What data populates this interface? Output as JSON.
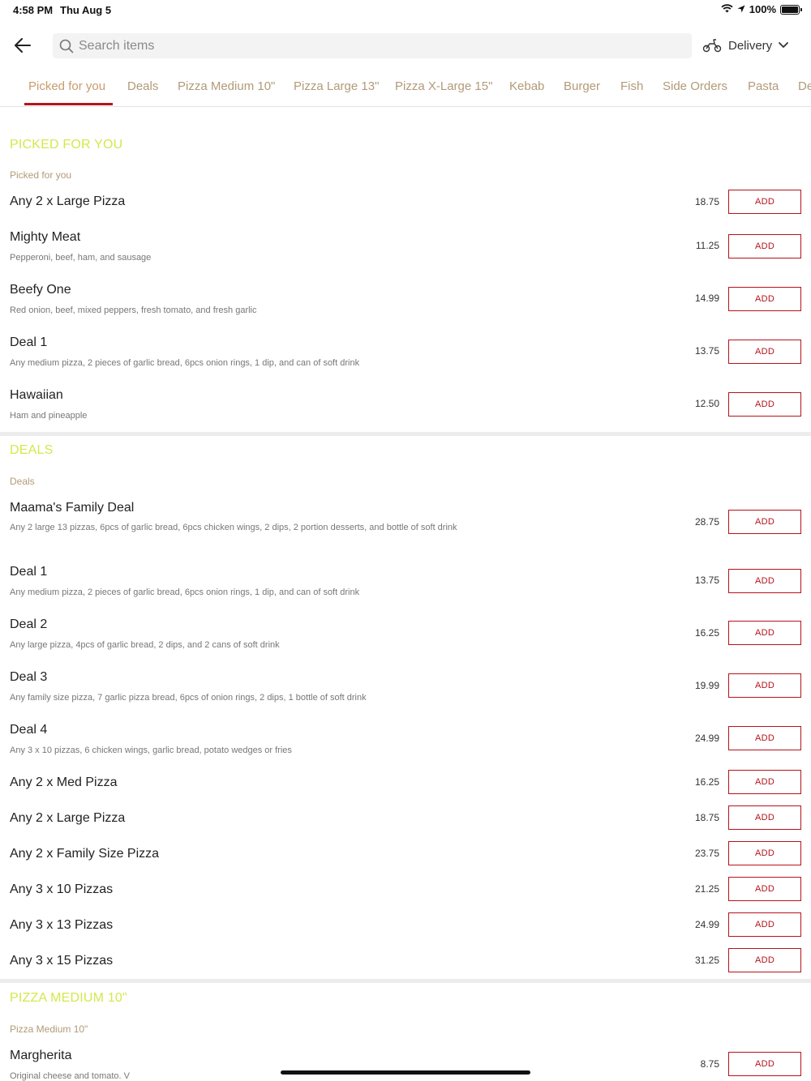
{
  "status_bar": {
    "time": "4:58 PM",
    "date": "Thu Aug 5",
    "battery": "100%",
    "battery_level": 1.0
  },
  "header": {
    "search_placeholder": "Search items",
    "delivery_label": "Delivery"
  },
  "tabs": [
    {
      "label": "Picked for you",
      "active": true
    },
    {
      "label": "Deals"
    },
    {
      "label": "Pizza Medium 10\""
    },
    {
      "label": "Pizza Large 13\""
    },
    {
      "label": "Pizza X-Large 15\""
    },
    {
      "label": "Kebab"
    },
    {
      "label": "Burger"
    },
    {
      "label": "Fish"
    },
    {
      "label": "Side Orders"
    },
    {
      "label": "Pasta"
    },
    {
      "label": "De"
    }
  ],
  "add_label": "ADD",
  "sections": [
    {
      "title": "PICKED FOR YOU",
      "subtitle": "Picked for you",
      "items": [
        {
          "name": "Any 2 x Large Pizza",
          "desc": "",
          "price": "18.75"
        },
        {
          "name": "Mighty Meat",
          "desc": "Pepperoni, beef, ham, and sausage",
          "price": "11.25"
        },
        {
          "name": "Beefy One",
          "desc": "Red onion, beef, mixed peppers, fresh tomato, and fresh garlic",
          "price": "14.99"
        },
        {
          "name": "Deal 1",
          "desc": "Any medium pizza, 2 pieces of garlic bread, 6pcs onion rings, 1 dip, and can of soft drink",
          "price": "13.75"
        },
        {
          "name": "Hawaiian",
          "desc": "Ham and pineapple",
          "price": "12.50"
        }
      ]
    },
    {
      "title": "DEALS",
      "subtitle": "Deals",
      "items": [
        {
          "name": "Maama's Family Deal",
          "desc": "Any 2 large 13 pizzas, 6pcs of garlic bread, 6pcs chicken wings, 2 dips, 2 portion desserts, and bottle of soft drink",
          "price": "28.75"
        },
        {
          "name": "Deal 1",
          "desc": "Any medium pizza, 2 pieces of garlic bread, 6pcs onion rings, 1 dip, and can of soft drink",
          "price": "13.75"
        },
        {
          "name": "Deal 2",
          "desc": "Any large pizza, 4pcs of garlic bread, 2 dips, and 2 cans of soft drink",
          "price": "16.25"
        },
        {
          "name": "Deal 3",
          "desc": "Any family size pizza, 7 garlic pizza bread, 6pcs of onion rings, 2 dips, 1 bottle of soft drink",
          "price": "19.99"
        },
        {
          "name": "Deal 4",
          "desc": "Any 3 x 10 pizzas, 6 chicken wings, garlic bread, potato wedges or fries",
          "price": "24.99"
        },
        {
          "name": "Any 2 x Med Pizza",
          "desc": "",
          "price": "16.25"
        },
        {
          "name": "Any 2 x Large Pizza",
          "desc": "",
          "price": "18.75"
        },
        {
          "name": "Any 2 x Family Size Pizza",
          "desc": "",
          "price": "23.75"
        },
        {
          "name": "Any 3 x 10 Pizzas",
          "desc": "",
          "price": "21.25"
        },
        {
          "name": "Any 3 x 13 Pizzas",
          "desc": "",
          "price": "24.99"
        },
        {
          "name": "Any 3 x 15 Pizzas",
          "desc": "",
          "price": "31.25"
        }
      ]
    },
    {
      "title": "PIZZA MEDIUM 10\"",
      "subtitle": "Pizza Medium 10\"",
      "items": [
        {
          "name": "Margherita",
          "desc": "Original cheese and tomato. V",
          "price": "8.75"
        }
      ]
    }
  ]
}
